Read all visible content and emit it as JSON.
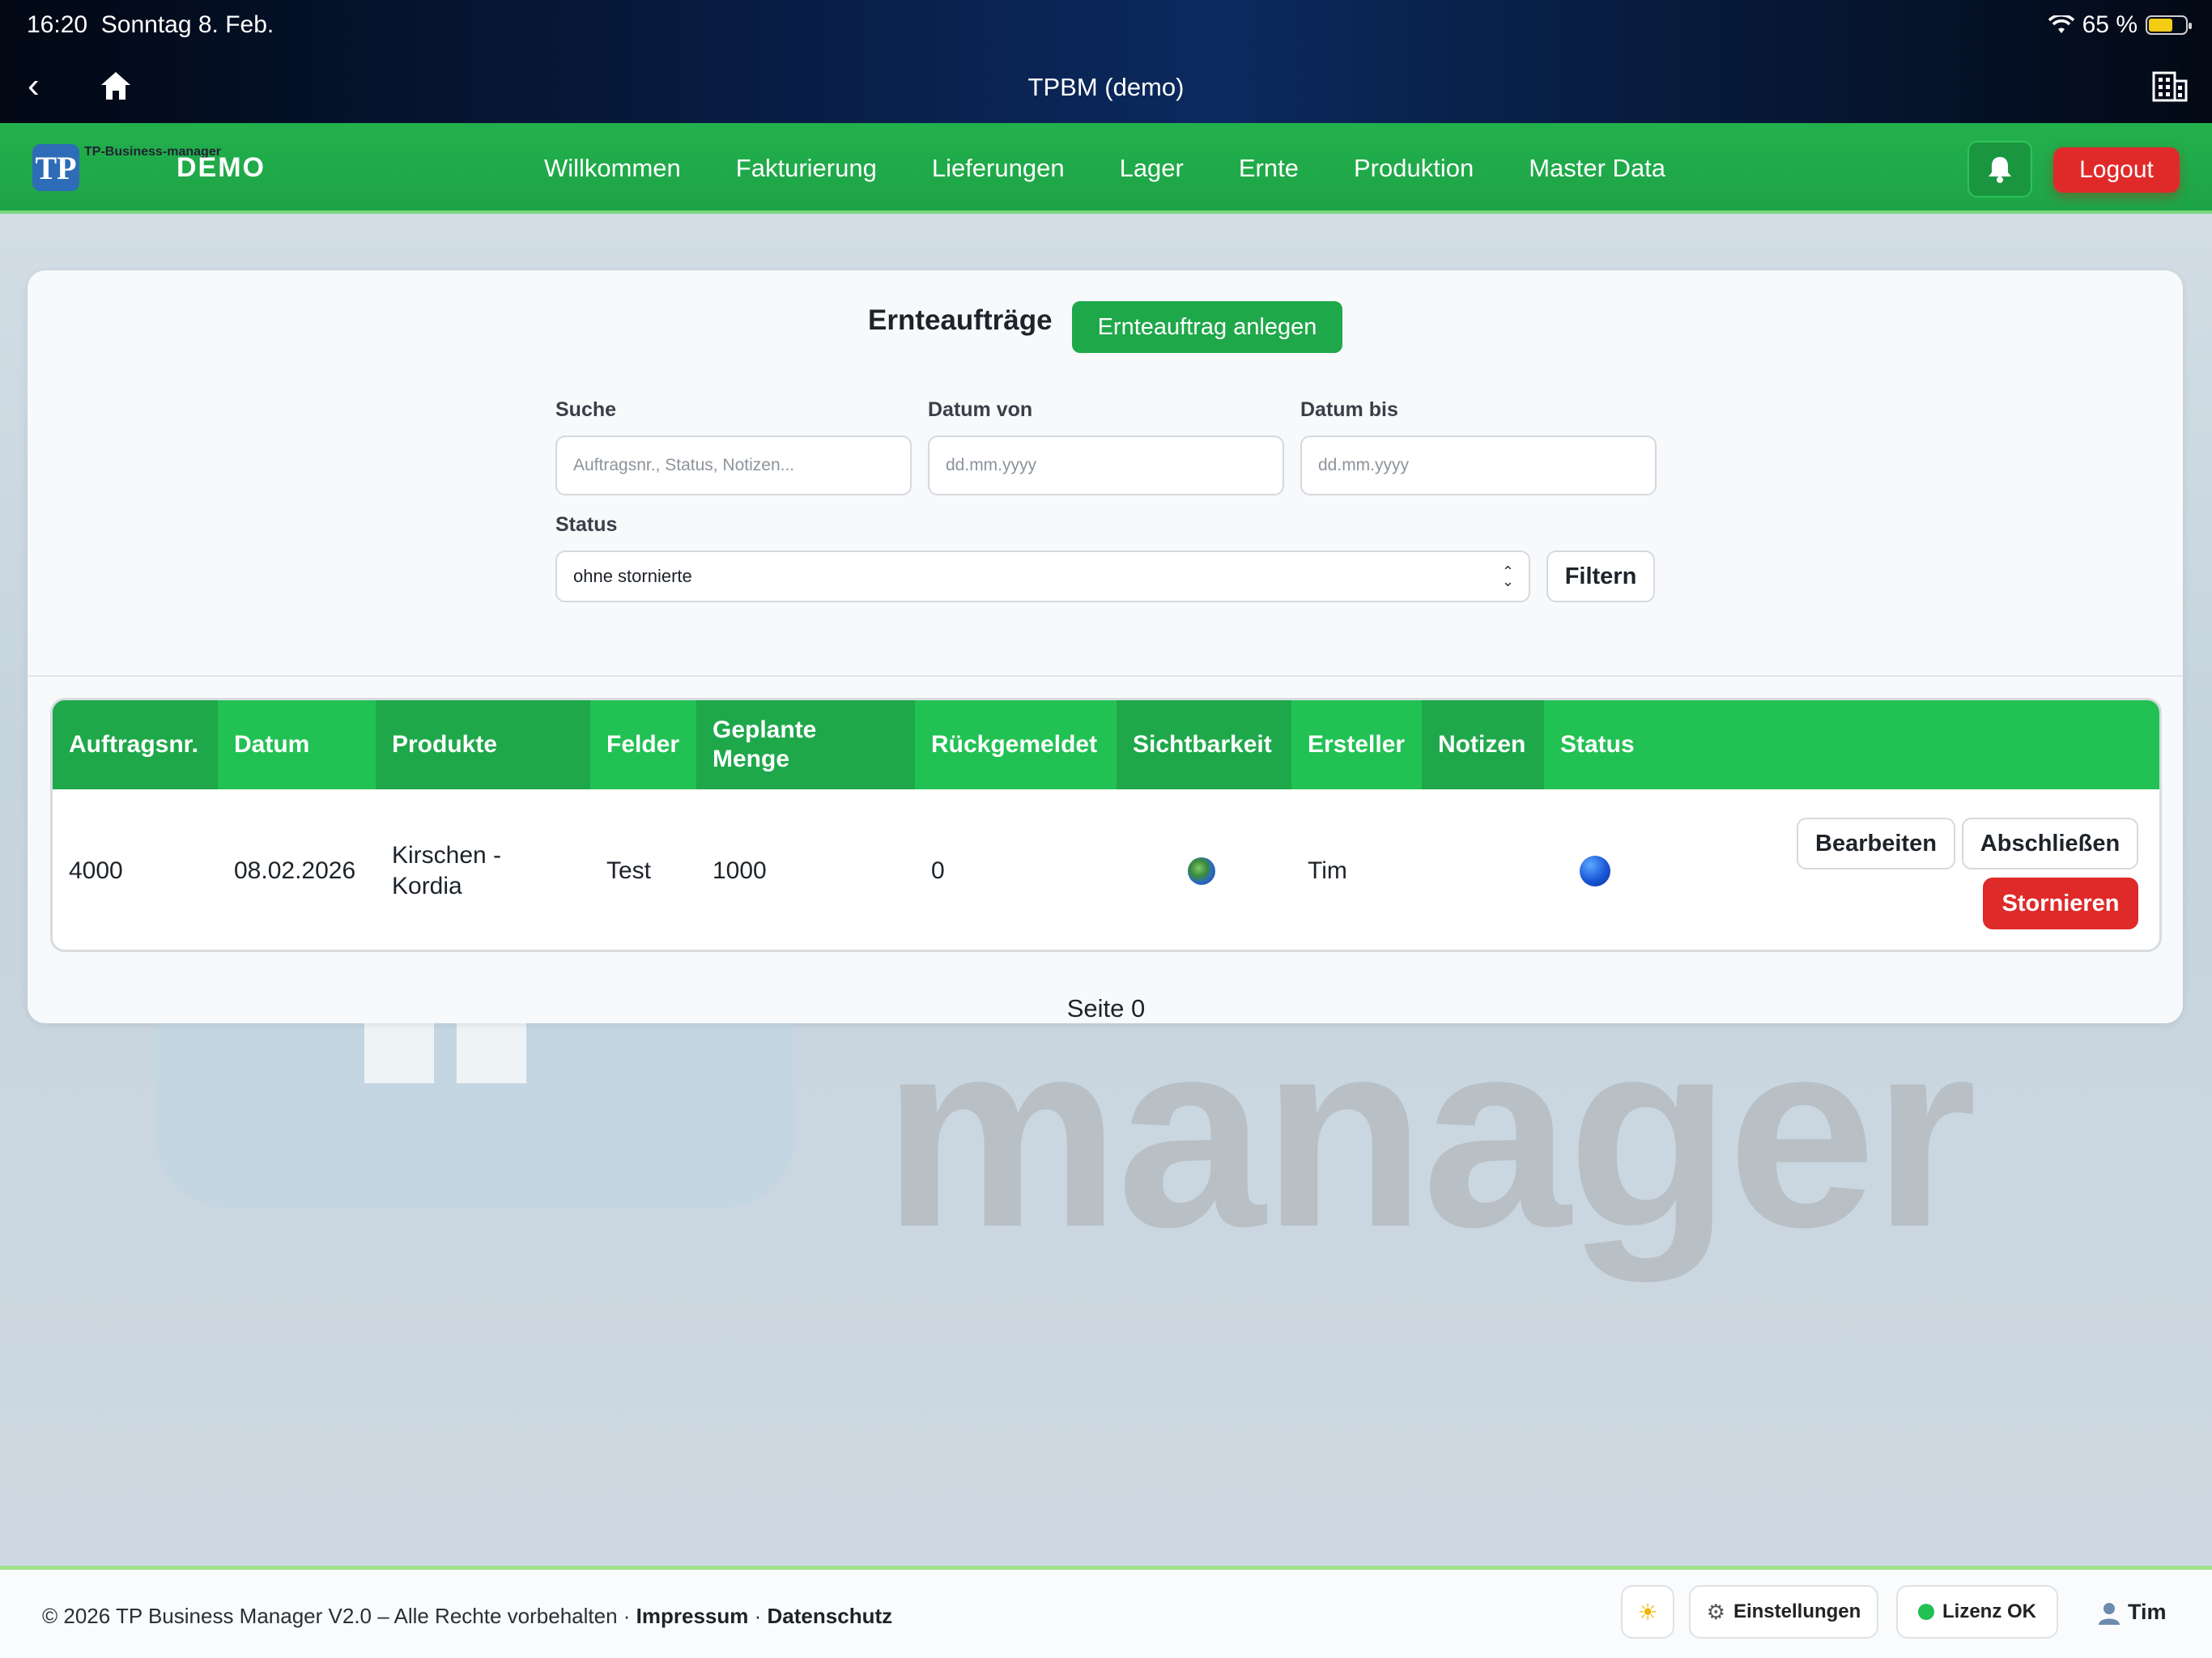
{
  "status_bar": {
    "time": "16:20",
    "date": "Sonntag 8. Feb.",
    "battery": "65 %",
    "battery_level": 0.65
  },
  "ios_nav": {
    "title": "TPBM (demo)"
  },
  "appbar": {
    "logo_text": "TP-Business-manager",
    "brand": "DEMO",
    "nav": [
      "Willkommen",
      "Fakturierung",
      "Lieferungen",
      "Lager",
      "Ernte",
      "Produktion",
      "Master Data"
    ],
    "logout": "Logout"
  },
  "page": {
    "title": "Ernteaufträge",
    "create_button": "Ernteauftrag anlegen",
    "filters": {
      "search_label": "Suche",
      "search_placeholder": "Auftragsnr., Status, Notizen...",
      "from_label": "Datum von",
      "from_placeholder": "dd.mm.yyyy",
      "to_label": "Datum bis",
      "to_placeholder": "dd.mm.yyyy",
      "status_label": "Status",
      "status_value": "ohne stornierte",
      "filter_button": "Filtern"
    },
    "table": {
      "columns": [
        "Auftragsnr.",
        "Datum",
        "Produkte",
        "Felder",
        "Geplante Menge",
        "Rückgemeldet",
        "Sichtbarkeit",
        "Ersteller",
        "Notizen",
        "Status"
      ],
      "rows": [
        {
          "order_no": "4000",
          "date": "08.02.2026",
          "products": "Kirschen - Kordia",
          "fields": "Test",
          "planned_qty": "1000",
          "reported": "0",
          "visibility_icon": "globe-icon",
          "creator": "Tim",
          "notes": "",
          "status_icon": "blue-circle-icon",
          "actions": {
            "edit": "Bearbeiten",
            "close": "Abschließen",
            "cancel": "Stornieren"
          }
        }
      ]
    },
    "pager": "Seite 0"
  },
  "watermark": {
    "text": "manager"
  },
  "footer": {
    "copyright": "© 2026 TP Business Manager V2.0 – Alle Rechte vorbehalten ·",
    "impressum": "Impressum",
    "separator": "·",
    "datenschutz": "Datenschutz",
    "theme_icon": "sun-icon",
    "settings": "Einstellungen",
    "license": "Lizenz OK",
    "user": "Tim"
  },
  "colors": {
    "primary_green": "#22c154",
    "danger_red": "#df2a2a",
    "status_blue": "#1a56d6"
  }
}
